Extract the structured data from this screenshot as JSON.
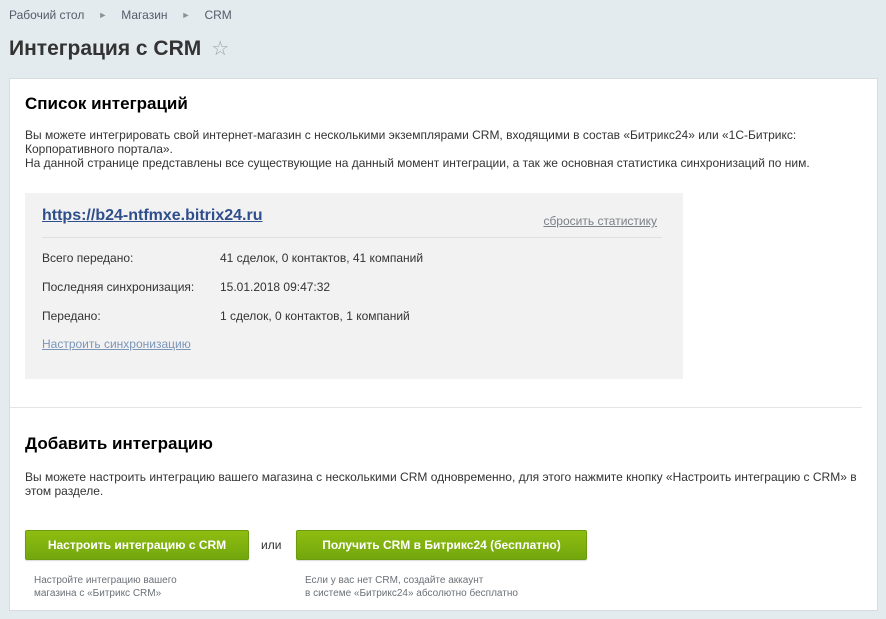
{
  "breadcrumb": {
    "items": [
      "Рабочий стол",
      "Магазин",
      "CRM"
    ]
  },
  "page": {
    "title": "Интеграция с CRM"
  },
  "integrations": {
    "title": "Список интеграций",
    "desc_line1": "Вы можете интегрировать свой интернет-магазин с несколькими экземплярами CRM, входящими в состав «Битрикс24» или «1С-Битрикс: Корпоративного портала».",
    "desc_line2": "На данной странице представлены все существующие на данный момент интеграции, а так же основная статистика синхронизаций по ним.",
    "card": {
      "url": "https://b24-ntfmxe.bitrix24.ru",
      "reset_label": "сбросить статистику",
      "stats": [
        {
          "label": "Всего передано:",
          "value": "41 сделок, 0 контактов, 41 компаний"
        },
        {
          "label": "Последняя синхронизация:",
          "value": "15.01.2018 09:47:32"
        },
        {
          "label": "Передано:",
          "value": "1 сделок, 0 контактов, 1 компаний"
        }
      ],
      "setup_label": "Настроить синхронизацию"
    }
  },
  "add": {
    "title": "Добавить интеграцию",
    "desc": "Вы можете настроить интеграцию вашего магазина с несколькими CRM одновременно, для этого нажмите кнопку «Настроить интеграцию с CRM» в этом разделе.",
    "button_setup": "Настроить интеграцию с CRM",
    "or_text": "или",
    "button_get": "Получить CRM в Битрикс24 (бесплатно)",
    "hint_setup_line1": "Настройте интеграцию вашего",
    "hint_setup_line2": "магазина с «Битрикс CRM»",
    "hint_get_line1": "Если у вас нет CRM, создайте аккаунт",
    "hint_get_line2": "в системе «Битрикс24» абсолютно бесплатно"
  },
  "colors": {
    "accent_green": "#7ab00f",
    "link_blue": "#2f4f8c",
    "background": "#e4ebee"
  }
}
